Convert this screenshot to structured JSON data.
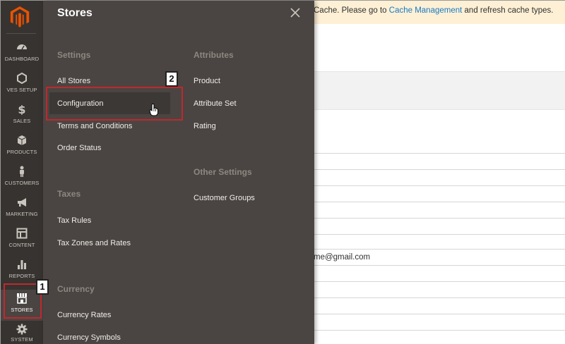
{
  "notice": {
    "prefix": "Cache. Please go to ",
    "link": "Cache Management",
    "suffix": " and refresh cache types."
  },
  "sidebar": {
    "items": [
      {
        "label": "DASHBOARD",
        "icon": "dashboard-icon"
      },
      {
        "label": "VES SETUP",
        "icon": "hexagon-icon"
      },
      {
        "label": "SALES",
        "icon": "dollar-icon"
      },
      {
        "label": "PRODUCTS",
        "icon": "box-icon"
      },
      {
        "label": "CUSTOMERS",
        "icon": "person-icon"
      },
      {
        "label": "MARKETING",
        "icon": "megaphone-icon"
      },
      {
        "label": "CONTENT",
        "icon": "layout-icon"
      },
      {
        "label": "REPORTS",
        "icon": "bar-chart-icon"
      },
      {
        "label": "STORES",
        "icon": "storefront-icon"
      },
      {
        "label": "SYSTEM",
        "icon": "gear-icon"
      }
    ]
  },
  "menu": {
    "title": "Stores",
    "settings": {
      "title": "Settings",
      "items": [
        "All Stores",
        "Configuration",
        "Terms and Conditions",
        "Order Status"
      ]
    },
    "taxes": {
      "title": "Taxes",
      "items": [
        "Tax Rules",
        "Tax Zones and Rates"
      ]
    },
    "currency": {
      "title": "Currency",
      "items": [
        "Currency Rates",
        "Currency Symbols"
      ]
    },
    "attributes": {
      "title": "Attributes",
      "items": [
        "Product",
        "Attribute Set",
        "Rating"
      ]
    },
    "other": {
      "title": "Other Settings",
      "items": [
        "Customer Groups"
      ]
    }
  },
  "page": {
    "email_fragment": "me@gmail.com"
  },
  "callouts": {
    "one": "1",
    "two": "2"
  },
  "colors": {
    "sidebar_bg": "#373330",
    "menu_bg": "#4a4542",
    "notice_bg": "#fdf0d5",
    "link": "#1979c3",
    "callout_red": "#c0282d",
    "logo_orange": "#eb5202"
  }
}
